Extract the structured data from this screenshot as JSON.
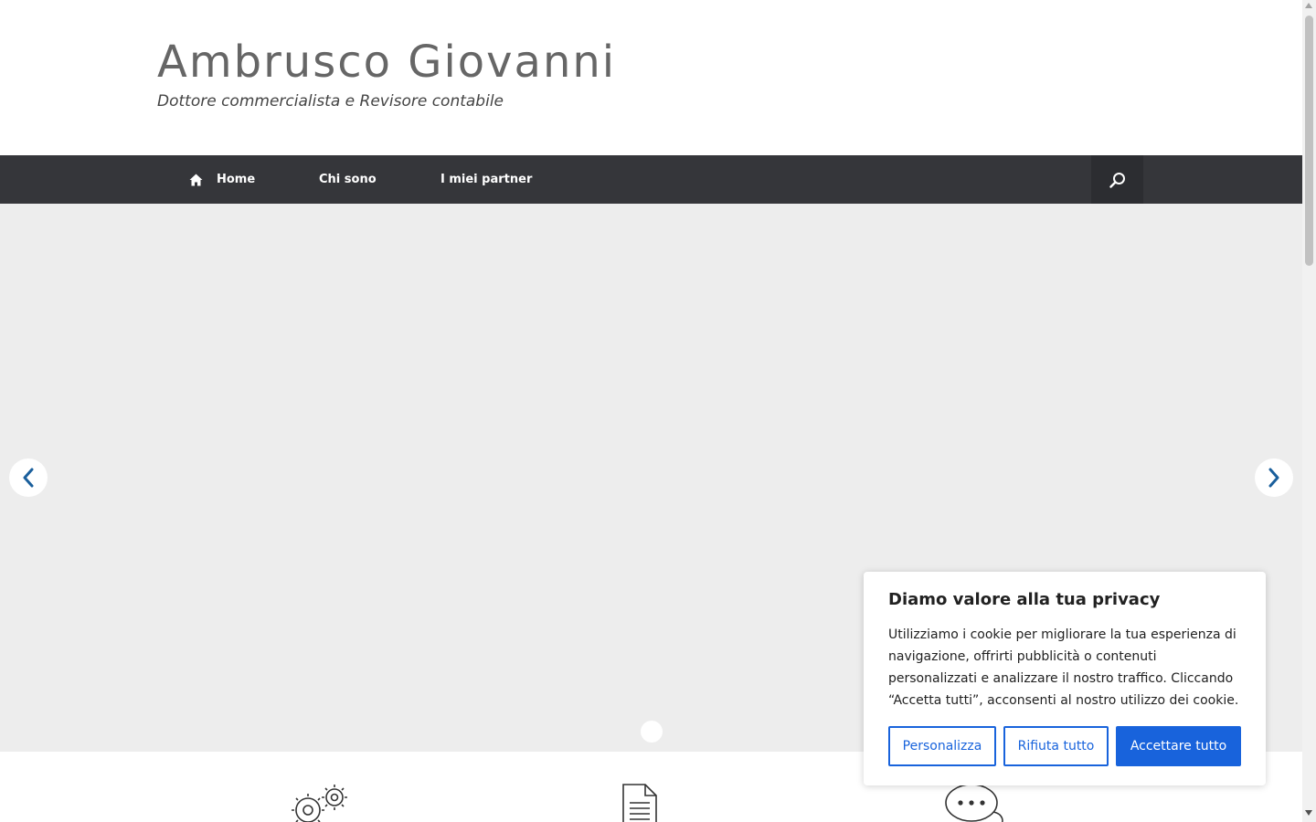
{
  "header": {
    "title": "Ambrusco Giovanni",
    "tagline": "Dottore commercialista e Revisore contabile"
  },
  "nav": {
    "items": [
      {
        "label": "Home",
        "icon": "home-icon"
      },
      {
        "label": "Chi sono"
      },
      {
        "label": "I miei partner"
      }
    ],
    "search_icon": "search-icon"
  },
  "slider": {
    "prev_icon": "chevron-left-icon",
    "next_icon": "chevron-right-icon",
    "slide_count": 1,
    "active_slide": 1
  },
  "features": {
    "icons": [
      "gears-icon",
      "document-icon",
      "chat-bubbles-icon"
    ]
  },
  "cookie_banner": {
    "title": "Diamo valore alla tua privacy",
    "text": "Utilizziamo i cookie per migliorare la tua esperienza di navigazione, offrirti pubblicità o contenuti personalizzati e analizzare il nostro traffico. Cliccando “Accetta tutti”, acconsenti al nostro utilizzo dei cookie.",
    "buttons": {
      "customize": "Personalizza",
      "reject": "Rifiuta tutto",
      "accept": "Accettare tutto"
    }
  },
  "colors": {
    "nav_bg": "#35363a",
    "slider_bg": "#ededed",
    "accent": "#1863dc",
    "arrow": "#1a5f9c"
  }
}
